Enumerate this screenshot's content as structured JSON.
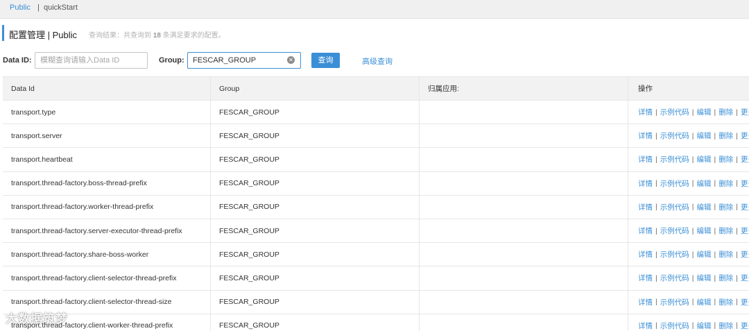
{
  "namespace_bar": {
    "active": "Public",
    "separator": "|",
    "item": "quickStart"
  },
  "header": {
    "title": "配置管理 | Public",
    "hint_prefix": "查询结果：共查询到",
    "hint_count": "18",
    "hint_suffix": "条满足要求的配置。"
  },
  "search": {
    "data_id_label": "Data ID:",
    "data_id_placeholder": "模糊查询请输入Data ID",
    "data_id_value": "",
    "group_label": "Group:",
    "group_value": "FESCAR_GROUP",
    "clear_symbol": "✕",
    "query_button": "查询",
    "advanced_link": "高级查询"
  },
  "table": {
    "columns": [
      "Data Id",
      "Group",
      "归属应用:",
      "操作"
    ],
    "actions": [
      "详情",
      "示例代码",
      "编辑",
      "删除",
      "更多"
    ],
    "rows": [
      {
        "data_id": "transport.type",
        "group": "FESCAR_GROUP",
        "app": ""
      },
      {
        "data_id": "transport.server",
        "group": "FESCAR_GROUP",
        "app": ""
      },
      {
        "data_id": "transport.heartbeat",
        "group": "FESCAR_GROUP",
        "app": ""
      },
      {
        "data_id": "transport.thread-factory.boss-thread-prefix",
        "group": "FESCAR_GROUP",
        "app": ""
      },
      {
        "data_id": "transport.thread-factory.worker-thread-prefix",
        "group": "FESCAR_GROUP",
        "app": ""
      },
      {
        "data_id": "transport.thread-factory.server-executor-thread-prefix",
        "group": "FESCAR_GROUP",
        "app": ""
      },
      {
        "data_id": "transport.thread-factory.share-boss-worker",
        "group": "FESCAR_GROUP",
        "app": ""
      },
      {
        "data_id": "transport.thread-factory.client-selector-thread-prefix",
        "group": "FESCAR_GROUP",
        "app": ""
      },
      {
        "data_id": "transport.thread-factory.client-selector-thread-size",
        "group": "FESCAR_GROUP",
        "app": ""
      },
      {
        "data_id": "transport.thread-factory.client-worker-thread-prefix",
        "group": "FESCAR_GROUP",
        "app": ""
      }
    ]
  },
  "watermark": "大数据筑梦"
}
